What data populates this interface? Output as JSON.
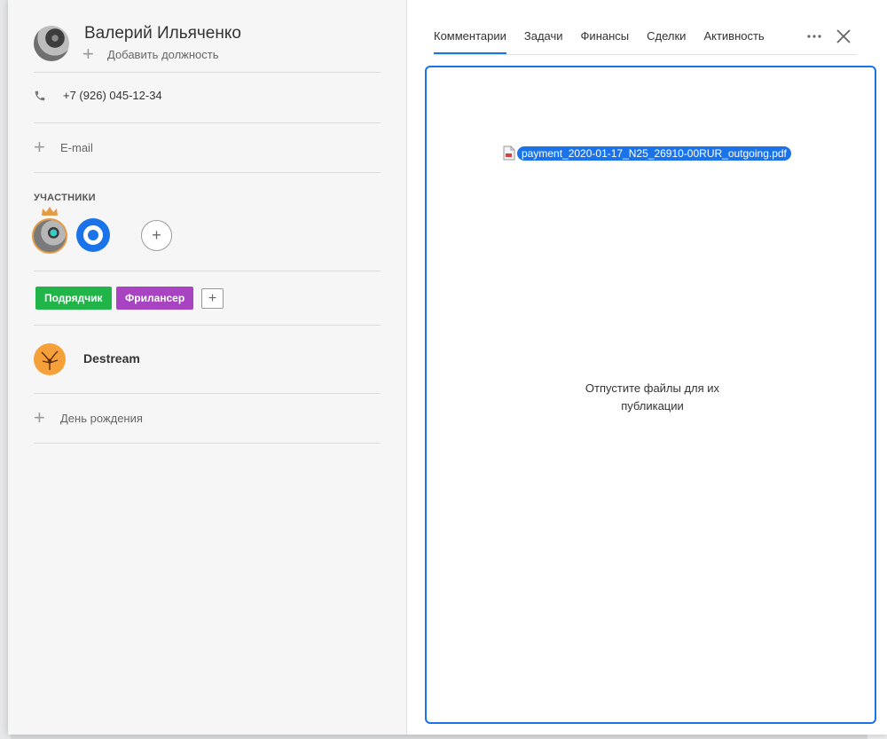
{
  "contact": {
    "name": "Валерий Ильяченко",
    "add_position": "Добавить должность",
    "phone": "+7 (926) 045-12-34",
    "email_placeholder": "E-mail",
    "participants_title": "УЧАСТНИКИ",
    "tags": [
      "Подрядчик",
      "Фрилансер"
    ],
    "company": "Destream",
    "birthday": "День рождения"
  },
  "tabs": [
    "Комментарии",
    "Задачи",
    "Финансы",
    "Сделки",
    "Активность"
  ],
  "dropzone": {
    "file_name": "payment_2020-01-17_N25_26910-00RUR_outgoing.pdf",
    "hint_line1": "Отпустите файлы для их",
    "hint_line2": "публикации"
  },
  "colors": {
    "accent": "#1a73e8",
    "tag_contractor": "#21b449",
    "tag_freelancer": "#a844c2",
    "crown": "#e39b45"
  }
}
